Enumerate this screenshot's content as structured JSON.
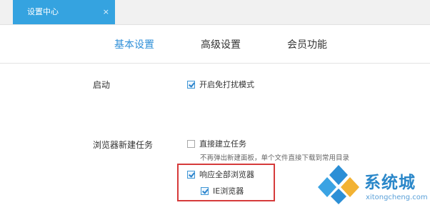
{
  "window": {
    "tab_title": "设置中心",
    "tab_close": "×"
  },
  "nav": {
    "tabs": [
      {
        "label": "基本设置",
        "active": true
      },
      {
        "label": "高级设置",
        "active": false
      },
      {
        "label": "会员功能",
        "active": false
      }
    ]
  },
  "startup": {
    "label": "启动",
    "option": {
      "label": "开启免打扰模式",
      "checked": true
    }
  },
  "browser_task": {
    "label": "浏览器新建任务",
    "direct_create": {
      "label": "直接建立任务",
      "checked": false
    },
    "direct_create_hint": "不再弹出新建面板，单个文件直接下载到常用目录",
    "respond_all": {
      "label": "响应全部浏览器",
      "checked": true
    },
    "sub_browser": {
      "label": "IE浏览器",
      "checked": true
    }
  },
  "watermark": {
    "brand": "系统城",
    "url": "xitongcheng.com"
  },
  "colors": {
    "accent": "#35a3e0",
    "active_tab_text": "#2f8fd8",
    "highlight": "#d63a3a",
    "watermark": "#2a87c9"
  }
}
